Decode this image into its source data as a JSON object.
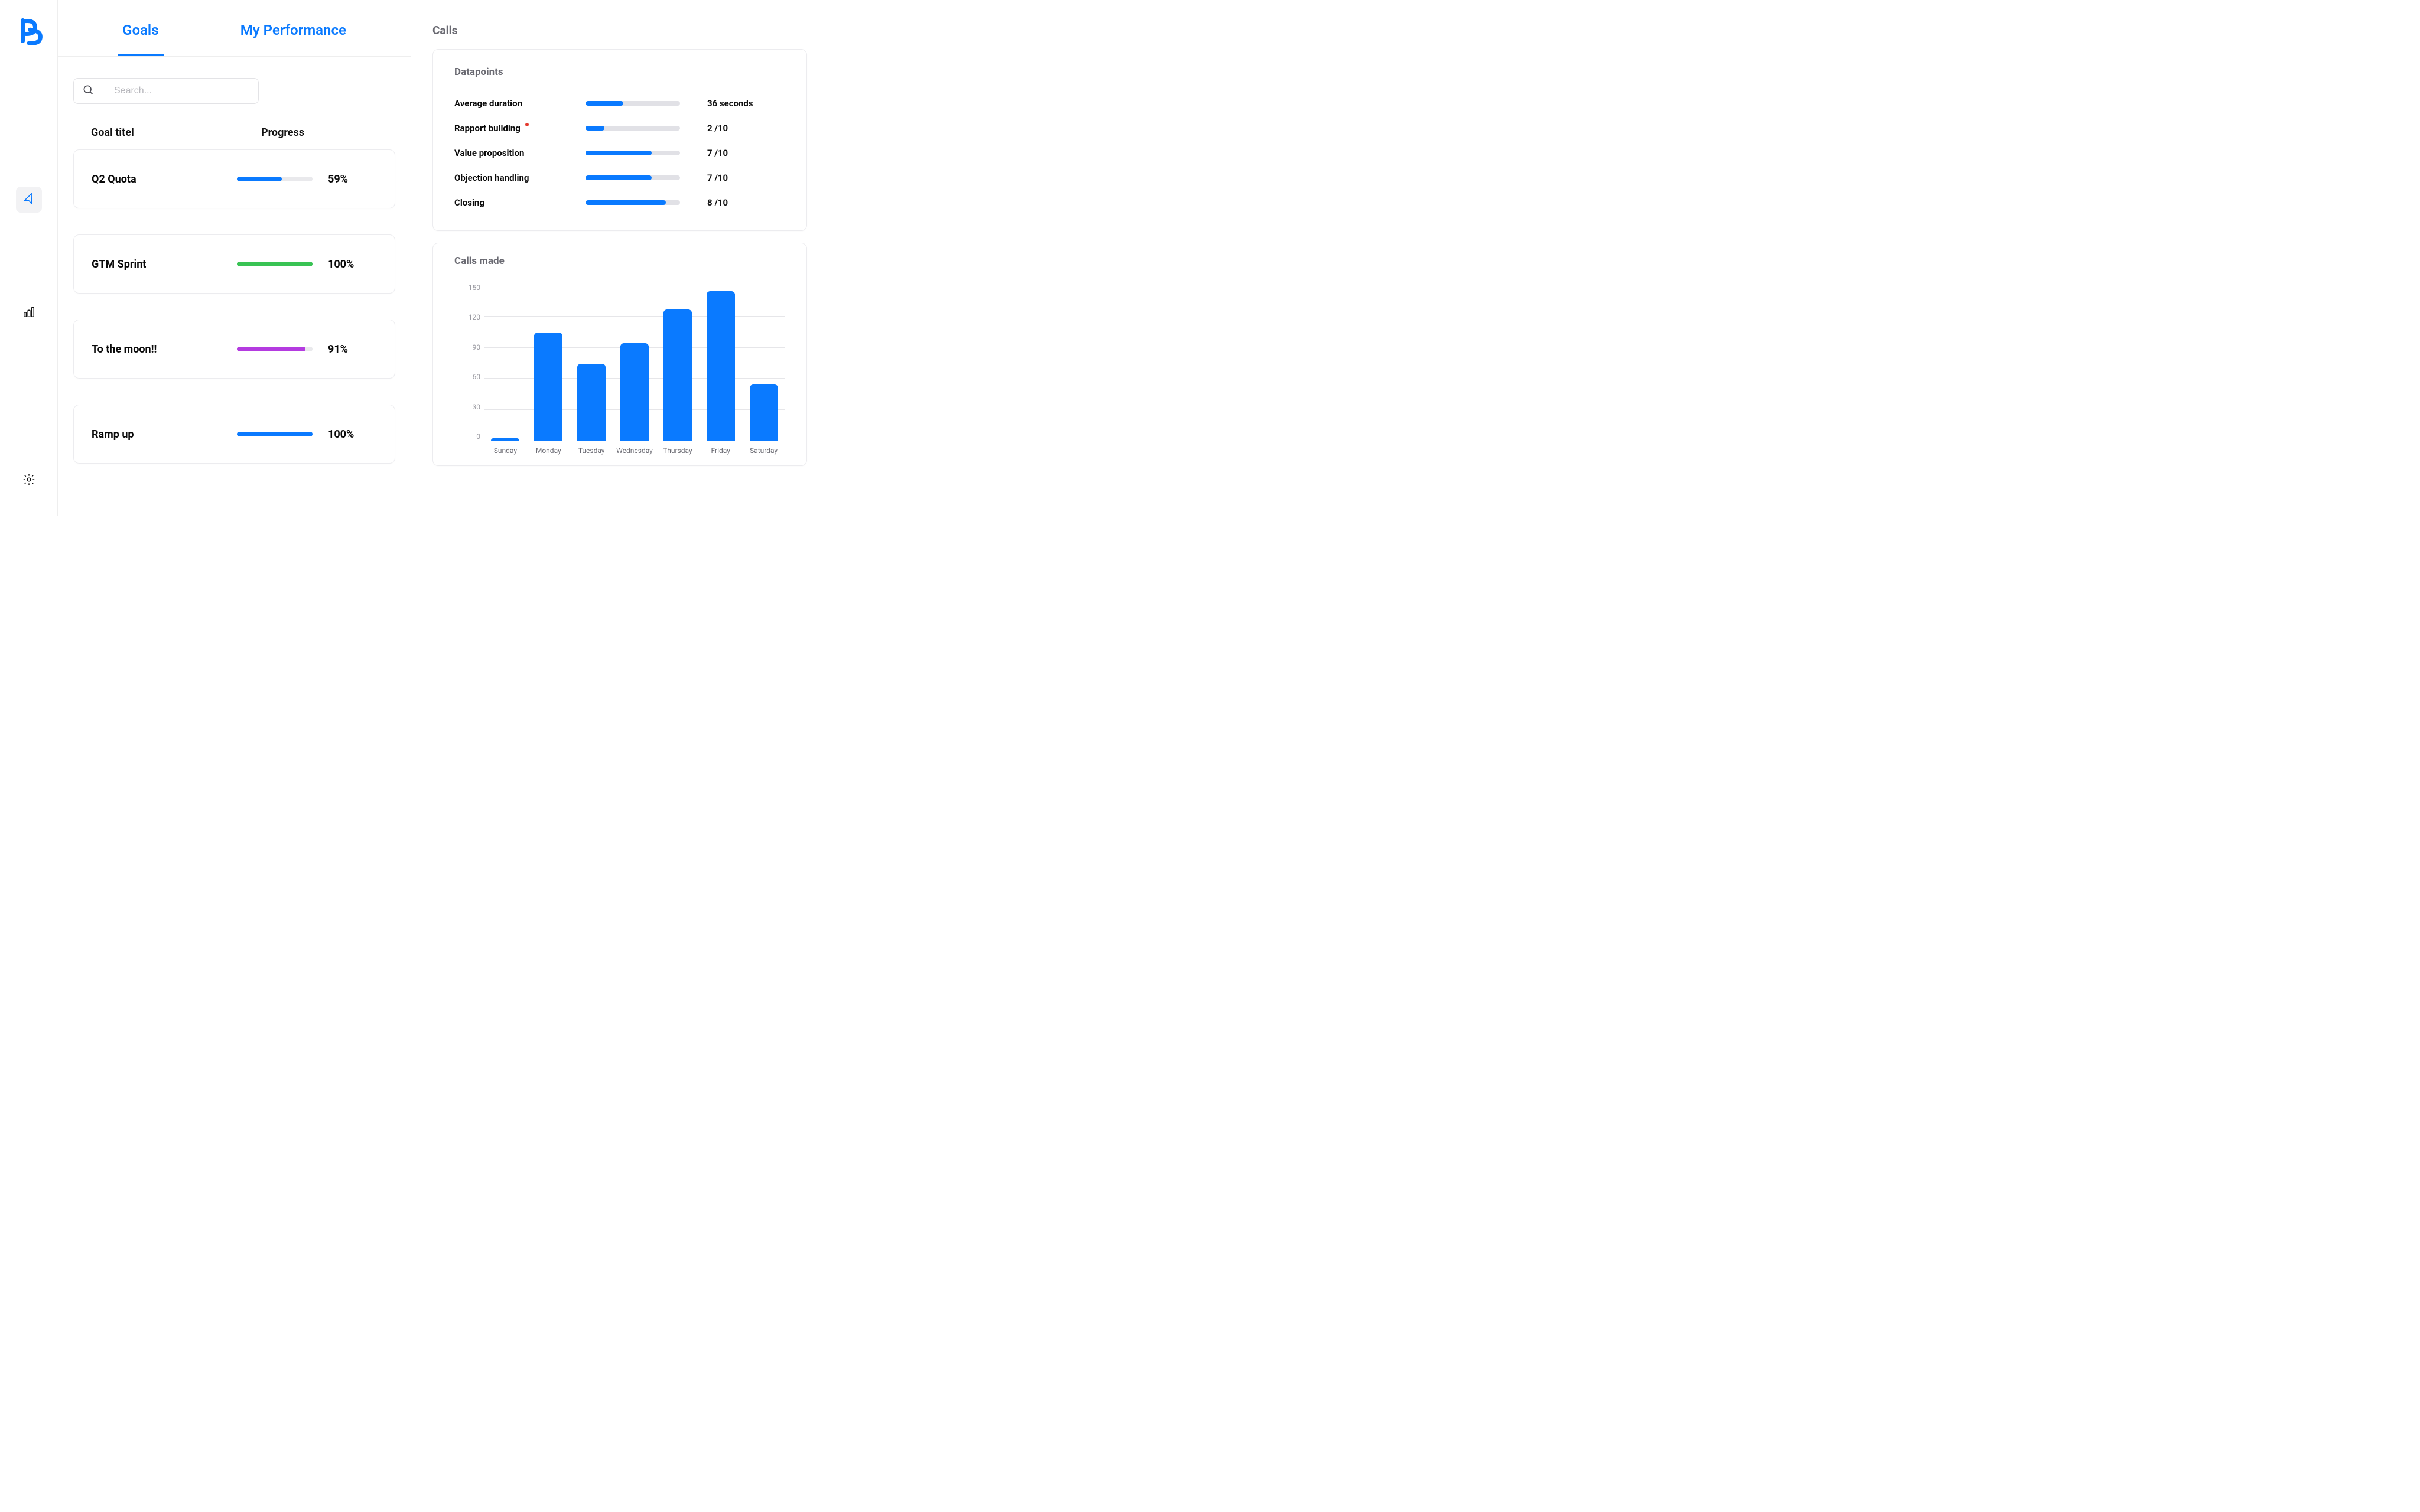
{
  "sidebar": {
    "logo_icon": "pb-logo",
    "items": [
      {
        "name": "nav-arrow-icon",
        "active": true
      },
      {
        "name": "bar-chart-icon",
        "active": false
      },
      {
        "name": "gear-icon",
        "active": false
      }
    ]
  },
  "tabs": {
    "goals": "Goals",
    "my_performance": "My Performance",
    "active": "goals"
  },
  "search": {
    "placeholder": "Search..."
  },
  "list_header": {
    "title": "Goal titel",
    "progress": "Progress"
  },
  "goals": [
    {
      "title": "Q2 Quota",
      "progress_pct": 59,
      "pct_label": "59%",
      "color": "#0a7aff"
    },
    {
      "title": "GTM Sprint",
      "progress_pct": 100,
      "pct_label": "100%",
      "color": "#39c354"
    },
    {
      "title": "To the moon!!",
      "progress_pct": 91,
      "pct_label": "91%",
      "color": "#b43be0"
    },
    {
      "title": "Ramp up",
      "progress_pct": 100,
      "pct_label": "100%",
      "color": "#0a7aff"
    }
  ],
  "calls": {
    "section_title": "Calls",
    "datapoints_title": "Datapoints",
    "datapoints": [
      {
        "label": "Average duration",
        "alert": false,
        "value_label": "36 seconds",
        "pct": 40
      },
      {
        "label": "Rapport building",
        "alert": true,
        "value_label": "2 /10",
        "pct": 20
      },
      {
        "label": "Value proposition",
        "alert": false,
        "value_label": "7 /10",
        "pct": 70
      },
      {
        "label": "Objection handling",
        "alert": false,
        "value_label": "7 /10",
        "pct": 70
      },
      {
        "label": "Closing",
        "alert": false,
        "value_label": "8 /10",
        "pct": 85
      }
    ],
    "chart_title": "Calls made",
    "y_ticks": [
      "150",
      "120",
      "90",
      "60",
      "30",
      "0"
    ]
  },
  "chart_data": {
    "type": "bar",
    "title": "Calls made",
    "xlabel": "",
    "ylabel": "",
    "ylim": [
      0,
      150
    ],
    "y_ticks": [
      0,
      30,
      60,
      90,
      120,
      150
    ],
    "grid": true,
    "categories": [
      "Sunday",
      "Monday",
      "Tuesday",
      "Wednesday",
      "Thursday",
      "Friday",
      "Saturday"
    ],
    "values": [
      2,
      104,
      74,
      94,
      126,
      144,
      54
    ]
  },
  "colors": {
    "accent": "#0a7aff",
    "green": "#39c354",
    "purple": "#b43be0",
    "alert": "#e43b2f",
    "muted": "#6a6a72"
  }
}
